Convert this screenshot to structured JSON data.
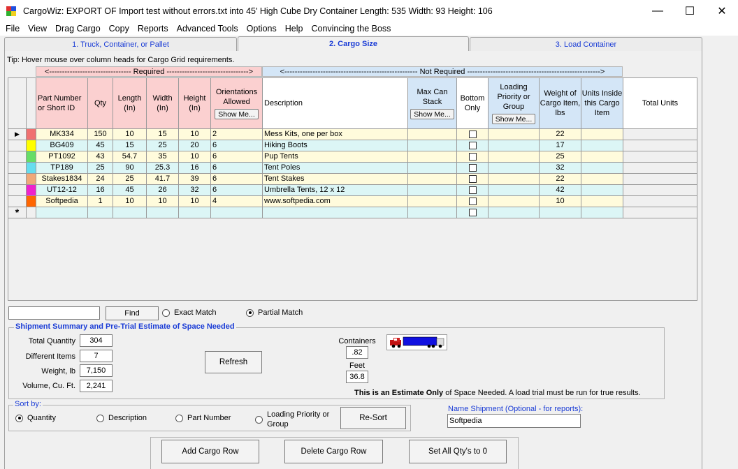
{
  "window": {
    "title": "CargoWiz:  EXPORT OF Import test without errors.txt into  45' High Cube Dry Container  Length: 535  Width: 93  Height: 106",
    "minimize": "—",
    "maximize": "☐",
    "close": "✕"
  },
  "menu": [
    "File",
    "View",
    "Drag Cargo",
    "Copy",
    "Reports",
    "Advanced Tools",
    "Options",
    "Help",
    "Convincing the Boss"
  ],
  "tabs": [
    "1. Truck, Container, or Pallet",
    "2. Cargo Size",
    "3. Load Container"
  ],
  "tip": "Tip: Hover mouse over column heads for Cargo Grid requirements.",
  "bands": {
    "required": "<-------------------------------- Required -------------------------------->",
    "not_required": "<---------------------------------------------------- Not Required ---------------------------------------------------->"
  },
  "columns": {
    "part": "Part Number or Short ID",
    "qty": "Qty",
    "length": "Length (In)",
    "width": "Width (In)",
    "height": "Height (In)",
    "orient": "Orientations Allowed",
    "desc": "Description",
    "stack": "Max Can Stack",
    "bottom": "Bottom Only",
    "priority": "Loading Priority or Group",
    "weight": "Weight of Cargo Item, lbs",
    "units": "Units Inside this Cargo Item",
    "total": "Total Units",
    "show_me": "Show Me..."
  },
  "rows": [
    {
      "color": "#f07070",
      "part": "MK334",
      "qty": "150",
      "length": "10",
      "width": "15",
      "height": "10",
      "orient": "2",
      "desc": "Mess Kits, one per box",
      "weight": "22"
    },
    {
      "color": "#ffff00",
      "part": "BG409",
      "qty": "45",
      "length": "15",
      "width": "25",
      "height": "20",
      "orient": "6",
      "desc": "Hiking Boots",
      "weight": "17"
    },
    {
      "color": "#66dd66",
      "part": "PT1092",
      "qty": "43",
      "length": "54.7",
      "width": "35",
      "height": "10",
      "orient": "6",
      "desc": "Pup Tents",
      "weight": "25"
    },
    {
      "color": "#66ddee",
      "part": "TP189",
      "qty": "25",
      "length": "90",
      "width": "25.3",
      "height": "16",
      "orient": "6",
      "desc": "Tent Poles",
      "weight": "32"
    },
    {
      "color": "#f0a878",
      "part": "Stakes1834",
      "qty": "24",
      "length": "25",
      "width": "41.7",
      "height": "39",
      "orient": "6",
      "desc": "Tent Stakes",
      "weight": "22"
    },
    {
      "color": "#ee22cc",
      "part": "UT12-12",
      "qty": "16",
      "length": "45",
      "width": "26",
      "height": "32",
      "orient": "6",
      "desc": "Umbrella Tents, 12 x 12",
      "weight": "42"
    },
    {
      "color": "#ff6600",
      "part": "Softpedia",
      "qty": "1",
      "length": "10",
      "width": "10",
      "height": "10",
      "orient": "4",
      "desc": "www.softpedia.com",
      "weight": "10"
    }
  ],
  "new_row_marker": "*",
  "current_row_marker": "▶",
  "find": {
    "button": "Find",
    "exact": "Exact Match",
    "partial": "Partial Match"
  },
  "summary": {
    "title": "Shipment Summary and Pre-Trial Estimate of Space Needed",
    "total_qty_label": "Total Quantity",
    "total_qty": "304",
    "diff_items_label": "Different Items",
    "diff_items": "7",
    "weight_label": "Weight, lb",
    "weight": "7,150",
    "volume_label": "Volume, Cu. Ft.",
    "volume": "2,241",
    "refresh": "Refresh",
    "containers_label": "Containers",
    "containers": ".82",
    "feet_label": "Feet",
    "feet": "36.8",
    "note_bold": "This is an Estimate Only",
    "note_rest": " of Space Needed. A load trial must be run for true results."
  },
  "sort": {
    "title": "Sort by:",
    "quantity": "Quantity",
    "description": "Description",
    "part_number": "Part Number",
    "priority": "Loading Priority or Group",
    "resort": "Re-Sort"
  },
  "shipment": {
    "label": "Name Shipment (Optional - for reports):",
    "value": "Softpedia"
  },
  "buttons": {
    "add": "Add Cargo Row",
    "delete": "Delete Cargo Row",
    "zero": "Set All Qty's to 0"
  },
  "colors": {
    "accent_blue": "#1a3cd6",
    "required_bg": "#fbd0d0",
    "not_required_bg": "#d4e6f7",
    "row_yellow": "#fffbdc",
    "row_cyan": "#dcf6f6"
  }
}
